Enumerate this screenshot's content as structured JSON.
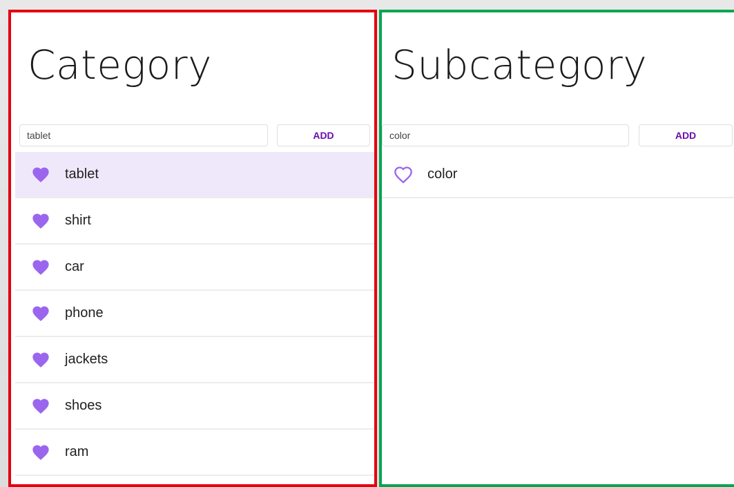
{
  "category": {
    "title": "Category",
    "input_value": "tablet",
    "add_label": "ADD",
    "items": [
      {
        "label": "tablet",
        "favorite": true,
        "selected": true
      },
      {
        "label": "shirt",
        "favorite": true,
        "selected": false
      },
      {
        "label": "car",
        "favorite": true,
        "selected": false
      },
      {
        "label": "phone",
        "favorite": true,
        "selected": false
      },
      {
        "label": "jackets",
        "favorite": true,
        "selected": false
      },
      {
        "label": "shoes",
        "favorite": true,
        "selected": false
      },
      {
        "label": "ram",
        "favorite": true,
        "selected": false
      }
    ]
  },
  "subcategory": {
    "title": "Subcategory",
    "input_value": "color",
    "add_label": "ADD",
    "items": [
      {
        "label": "color",
        "favorite": false,
        "selected": false
      }
    ]
  },
  "colors": {
    "accent": "#6a0dad",
    "heart": "#9b66ee",
    "selected_row": "#efe8fb",
    "left_frame": "#e3000f",
    "right_frame": "#00a650"
  },
  "icons": {
    "filled": "heart-icon",
    "outline": "heart-outline-icon"
  }
}
